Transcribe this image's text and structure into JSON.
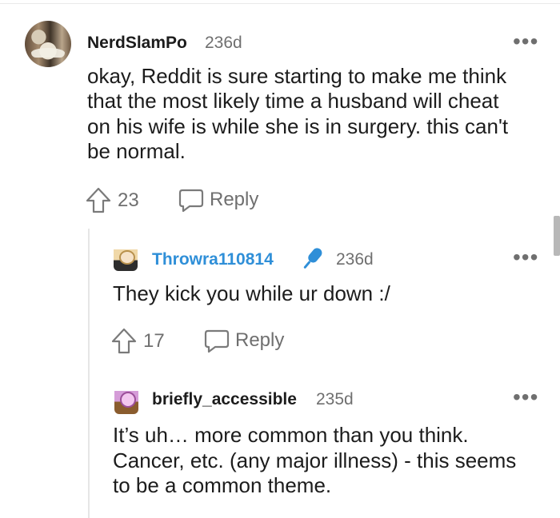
{
  "comments": [
    {
      "username": "NerdSlamPo",
      "age": "236d",
      "more": "•••",
      "lines": [
        "okay, Reddit is sure starting to make me think",
        "that the most likely time a husband will cheat",
        "on his wife is while she is in surgery. this can't",
        "be normal."
      ],
      "upvotes": "23",
      "reply_label": "Reply"
    },
    {
      "username": "Throwra110814",
      "username_color": "#2f8fd8",
      "age": "236d",
      "more": "•••",
      "lines": [
        "They kick you while ur down :/"
      ],
      "upvotes": "17",
      "reply_label": "Reply"
    },
    {
      "username": "briefly_accessible",
      "age": "235d",
      "more": "•••",
      "lines": [
        "It’s uh… more common than you think.",
        "Cancer, etc. (any major illness) - this seems",
        "to be a common theme."
      ]
    }
  ],
  "icons": {
    "upvote": "upvote-arrow-icon",
    "reply": "chat-bubble-icon",
    "badge": "microphone-icon"
  }
}
